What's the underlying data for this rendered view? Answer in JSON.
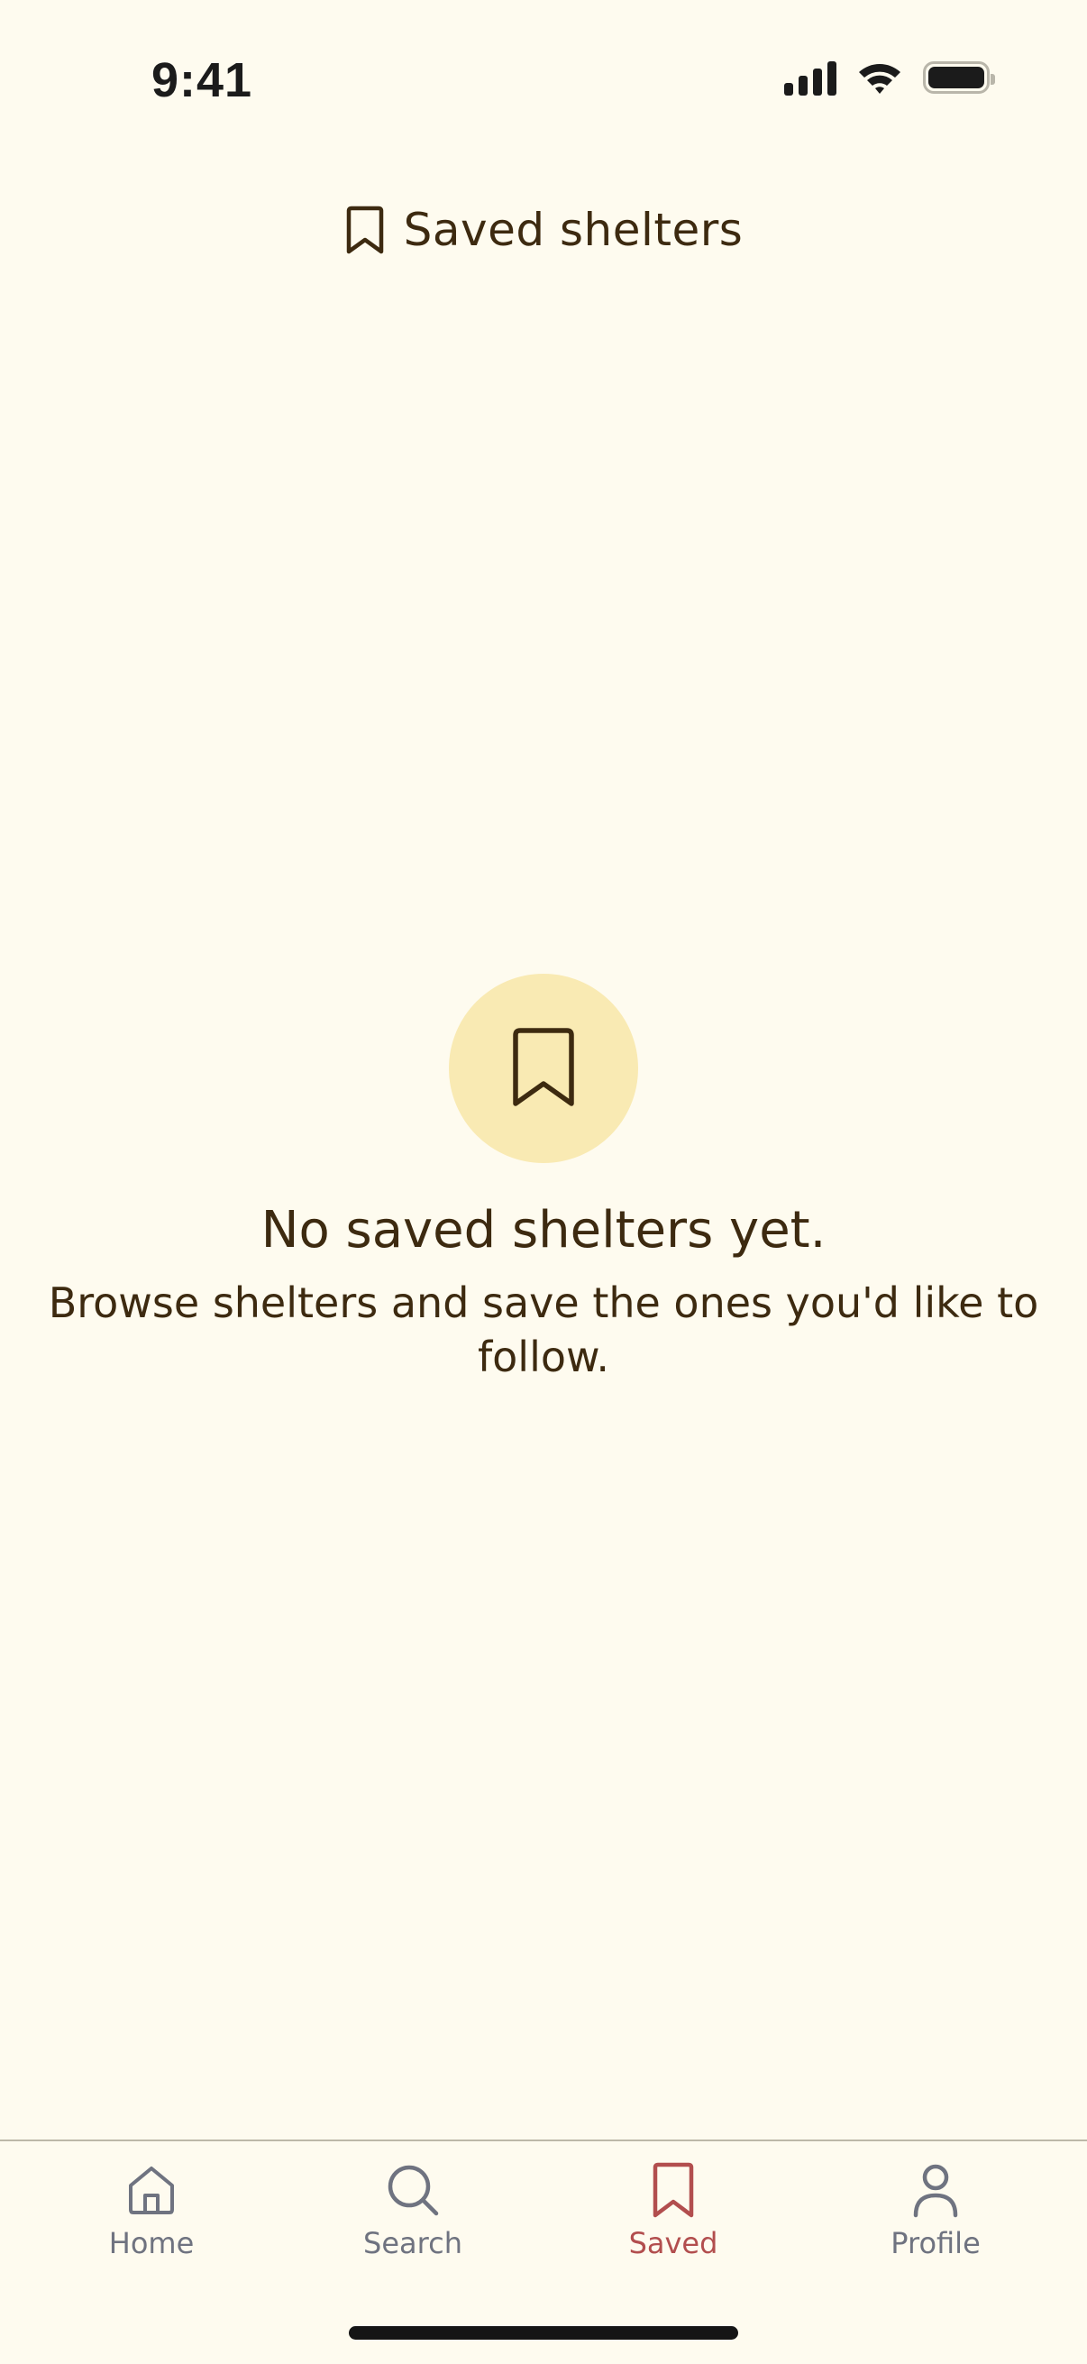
{
  "status_bar": {
    "time": "9:41",
    "icons": [
      "signal-icon",
      "wifi-icon",
      "battery-icon"
    ]
  },
  "header": {
    "icon": "bookmark-icon",
    "title": "Saved shelters"
  },
  "empty_state": {
    "icon": "bookmark-icon",
    "title": "No saved shelters yet.",
    "description": "Browse shelters and save the ones you'd like to follow."
  },
  "tab_bar": {
    "active": "saved",
    "items": [
      {
        "id": "home",
        "label": "Home",
        "icon": "home-icon"
      },
      {
        "id": "search",
        "label": "Search",
        "icon": "search-icon"
      },
      {
        "id": "saved",
        "label": "Saved",
        "icon": "bookmark-icon"
      },
      {
        "id": "profile",
        "label": "Profile",
        "icon": "person-icon"
      }
    ]
  },
  "colors": {
    "background": "#fefbef",
    "text": "#3d2a10",
    "accent": "#b24e4e",
    "inactive_tab": "#6f7380",
    "badge_background": "#f9eab3"
  }
}
